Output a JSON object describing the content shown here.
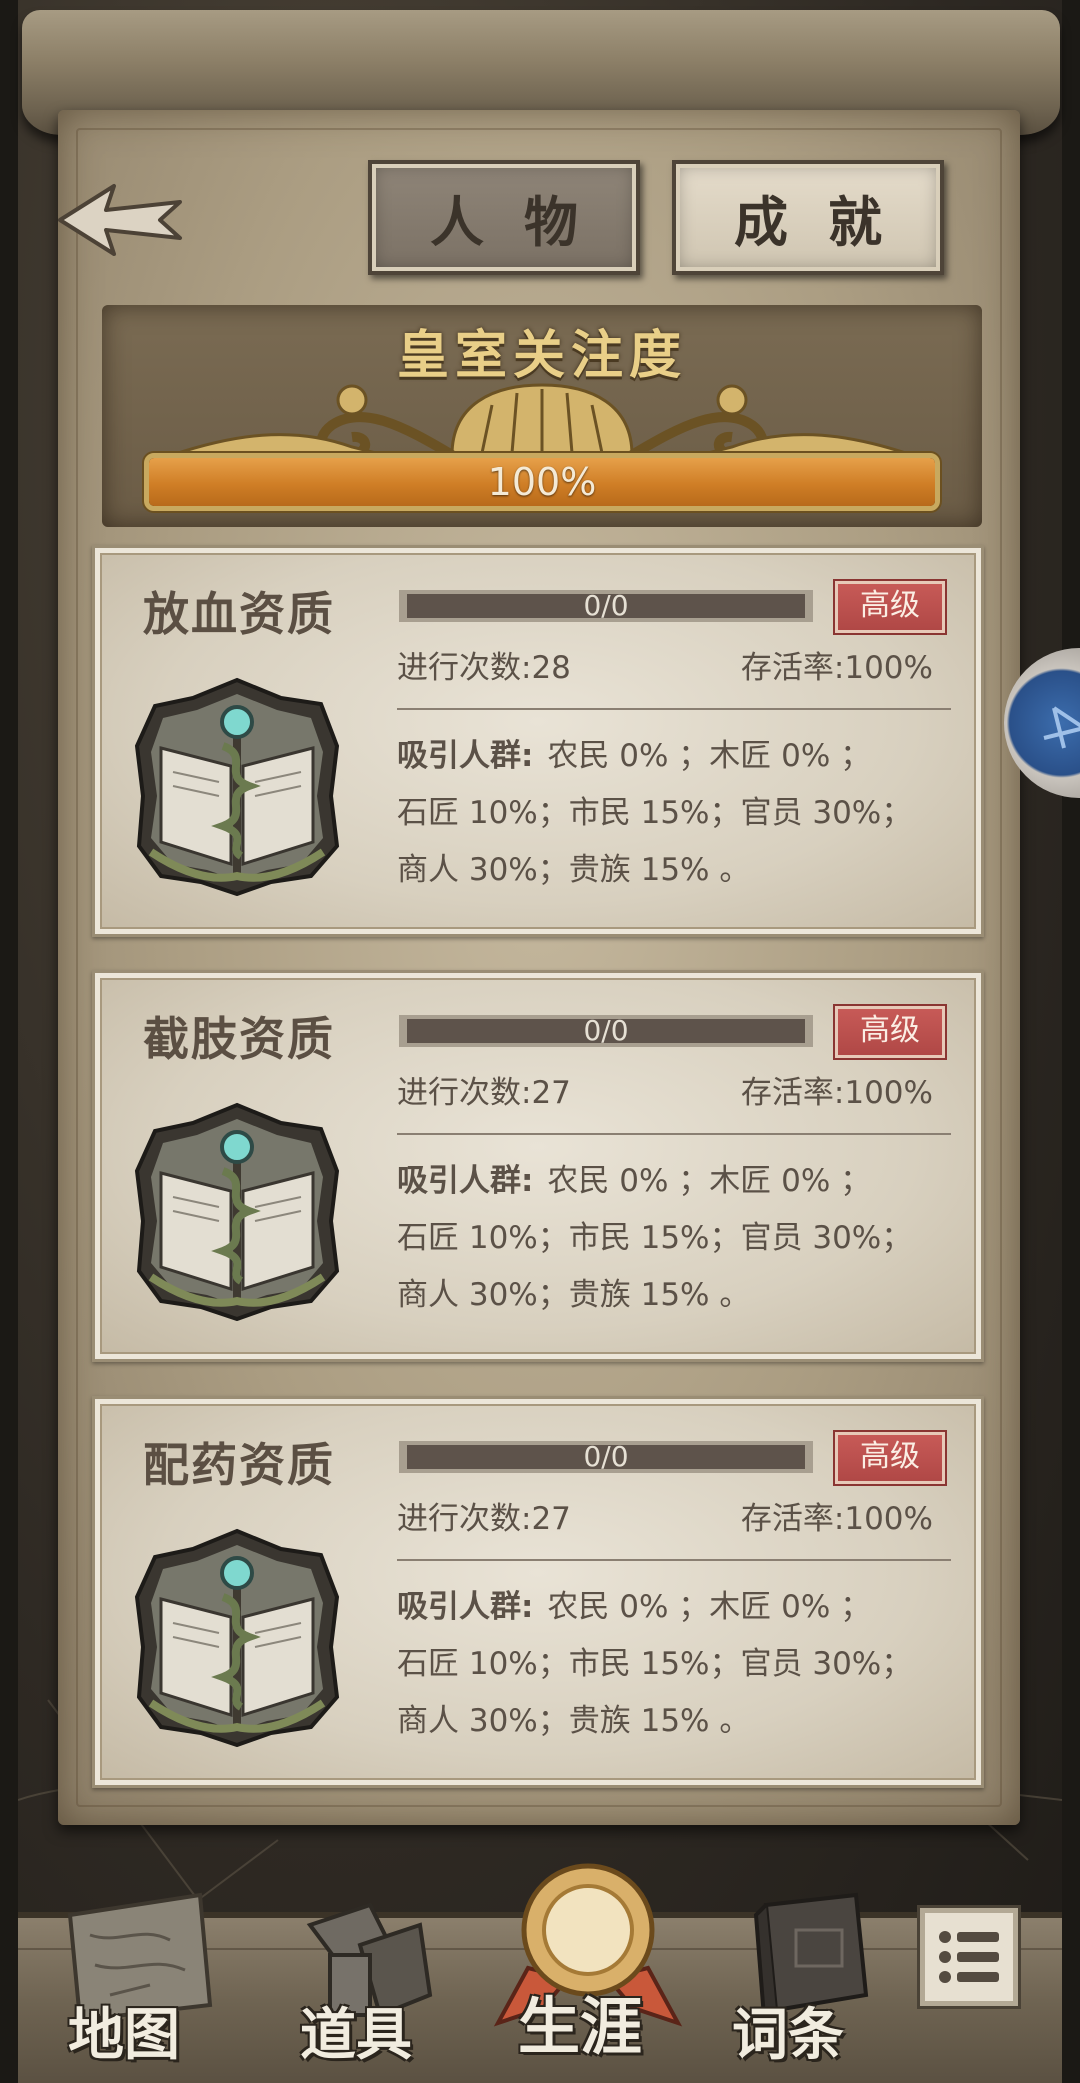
{
  "tabs": {
    "character": "人物",
    "achievements": "成就"
  },
  "royal": {
    "title": "皇室关注度",
    "progress_text": "100%",
    "progress": 1.0
  },
  "skills": [
    {
      "name": "放血资质",
      "progress_text": "0/0",
      "grade": "高级",
      "count_label": "进行次数:28",
      "survival_label": "存活率:100%",
      "attract_label": "吸引人群:",
      "attract_line1": "农民 0% ；木匠 0% ；",
      "attract_line2": "石匠 10%；市民 15%；官员 30%；",
      "attract_line3": "商人 30%；贵族 15% 。"
    },
    {
      "name": "截肢资质",
      "progress_text": "0/0",
      "grade": "高级",
      "count_label": "进行次数:27",
      "survival_label": "存活率:100%",
      "attract_label": "吸引人群:",
      "attract_line1": "农民 0% ；木匠 0% ；",
      "attract_line2": "石匠 10%；市民 15%；官员 30%；",
      "attract_line3": "商人 30%；贵族 15% 。"
    },
    {
      "name": "配药资质",
      "progress_text": "0/0",
      "grade": "高级",
      "count_label": "进行次数:27",
      "survival_label": "存活率:100%",
      "attract_label": "吸引人群:",
      "attract_line1": "农民 0% ；木匠 0% ；",
      "attract_line2": "石匠 10%；市民 15%；官员 30%；",
      "attract_line3": "商人 30%；贵族 15% 。"
    }
  ],
  "nav": {
    "map": "地图",
    "items": "道具",
    "career": "生涯",
    "entries": "词条"
  },
  "colors": {
    "grade_badge": "#b84f4c",
    "royal_bar": "#d4882f",
    "royal_title": "#e9cf88",
    "card_text": "#5b5147"
  },
  "icons": {
    "back": "back-arrow-icon",
    "side": "compass-icon",
    "menu": "list-menu-icon",
    "emblem": "book-staff-emblem-icon"
  }
}
